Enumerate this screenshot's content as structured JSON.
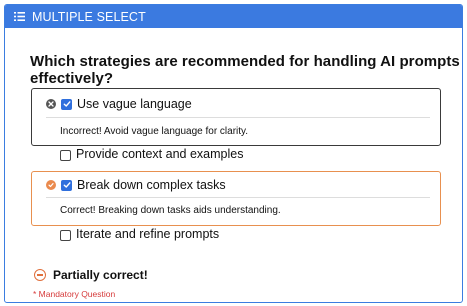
{
  "header": {
    "title": "MULTIPLE SELECT",
    "icon": "list-icon",
    "color": "#3b7ae0"
  },
  "question": {
    "text": "Which strategies are recommended for handling AI prompts effectively?"
  },
  "options": [
    {
      "label": "Use vague language",
      "checked": true,
      "status": "incorrect",
      "status_icon": "close-icon",
      "feedback": "Incorrect! Avoid vague language for clarity."
    },
    {
      "label": "Provide context and examples",
      "checked": false
    },
    {
      "label": "Break down complex tasks",
      "checked": true,
      "status": "correct",
      "status_icon": "check-circle-icon",
      "feedback": "Correct! Breaking down tasks aids understanding."
    },
    {
      "label": "Iterate and refine prompts",
      "checked": false
    }
  ],
  "result": {
    "text": "Partially correct!",
    "icon": "minus-circle-icon",
    "color": "#e0703d"
  },
  "mandatory": {
    "text": "* Mandatory Question",
    "color": "#d63b3b"
  }
}
